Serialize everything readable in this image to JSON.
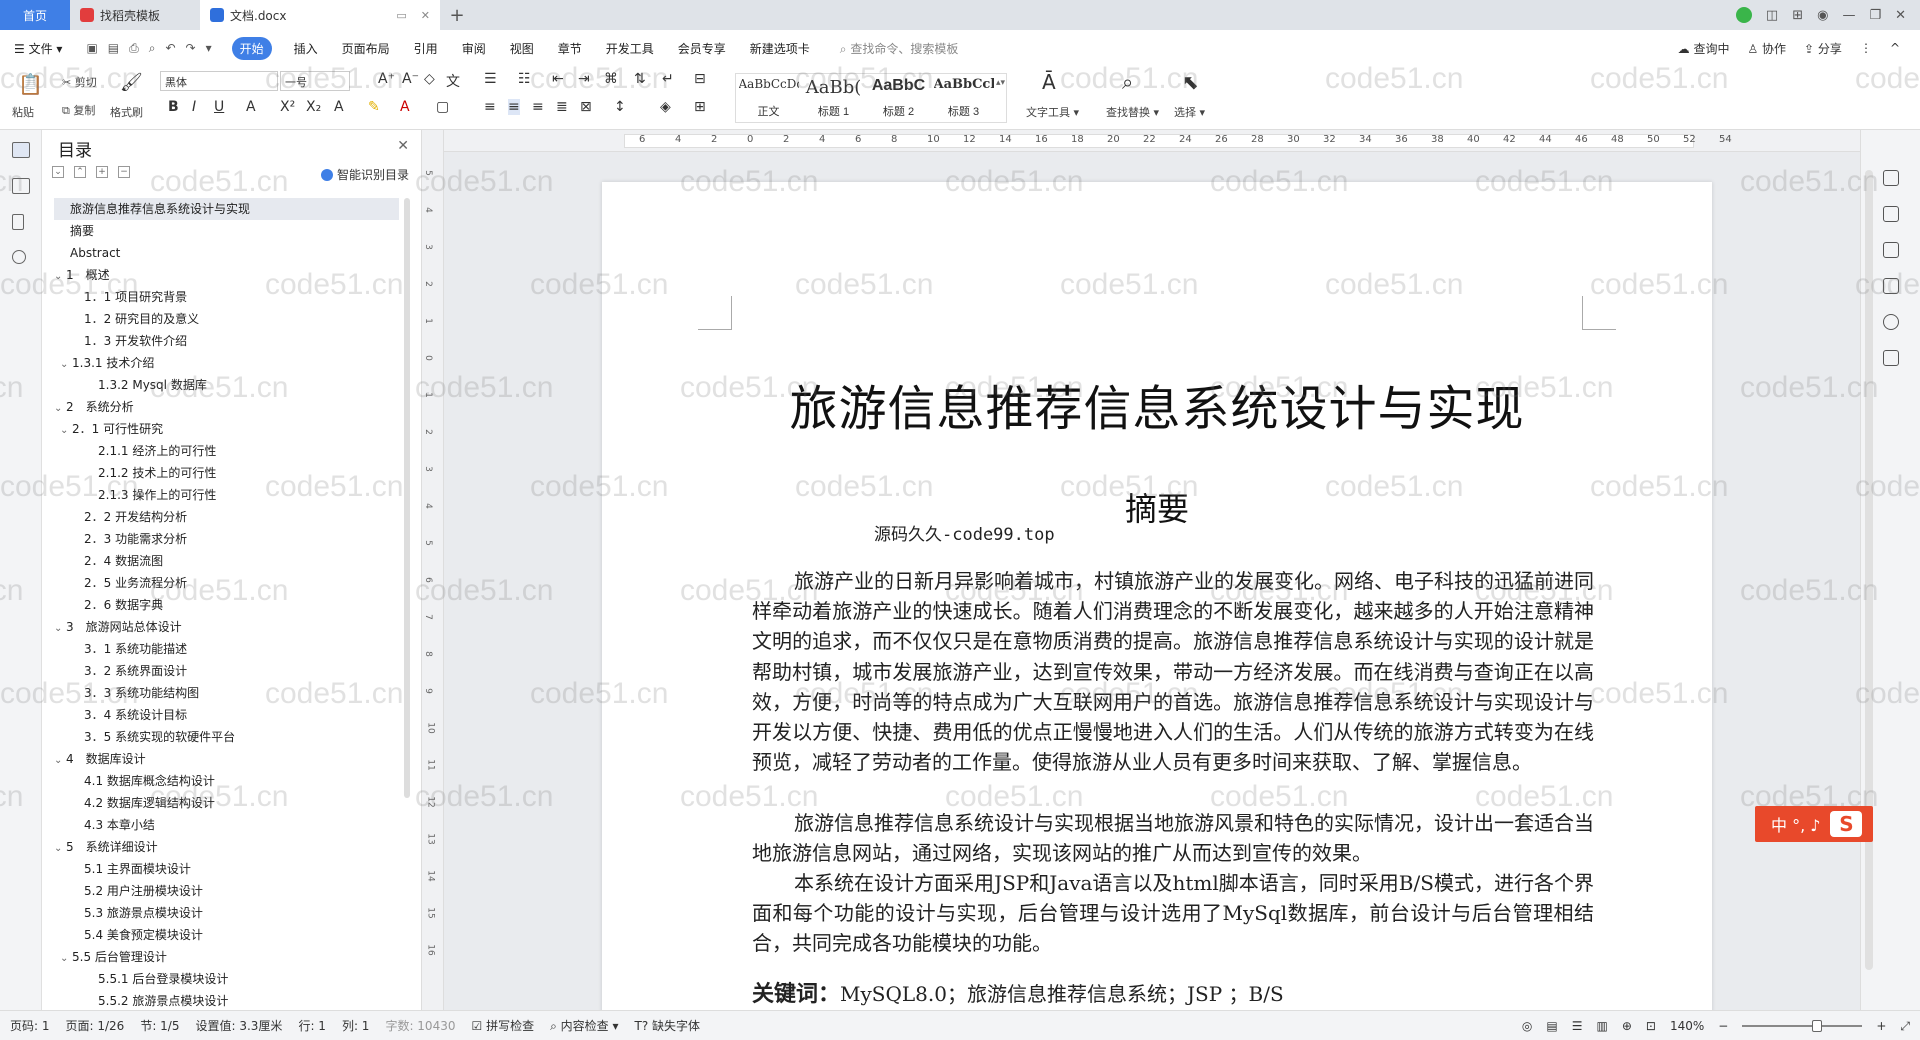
{
  "tabs": {
    "home": "首页",
    "template": "找稻壳模板",
    "doc": "文档.docx"
  },
  "menu": {
    "file": "文件",
    "items": [
      "开始",
      "插入",
      "页面布局",
      "引用",
      "审阅",
      "视图",
      "章节",
      "开发工具",
      "会员专享",
      "新建选项卡"
    ],
    "search_placeholder": "查找命令、搜索模板",
    "right": [
      "查询中",
      "协作",
      "分享"
    ]
  },
  "ribbon": {
    "paste": "粘贴",
    "cut": "剪切",
    "copy": "复制",
    "format_painter": "格式刷",
    "font_name": "黑体",
    "font_size": "一号",
    "styles": [
      {
        "preview": "AaBbCcDd",
        "label": "正文"
      },
      {
        "preview": "AaBb(",
        "label": "标题 1"
      },
      {
        "preview": "AaBbC",
        "label": "标题 2"
      },
      {
        "preview": "AaBbCcl",
        "label": "标题 3"
      }
    ],
    "text_tools": "文字工具",
    "find_replace": "查找替换",
    "select": "选择"
  },
  "toc": {
    "title": "目录",
    "smart": "智能识别目录",
    "items": [
      {
        "t": "旅游信息推荐信息系统设计与实现",
        "lvl": 0,
        "sel": true
      },
      {
        "t": "摘要",
        "lvl": 0
      },
      {
        "t": "Abstract",
        "lvl": 0
      },
      {
        "t": "1　概述",
        "lvl": 0,
        "arrow": true
      },
      {
        "t": "1．1 项目研究背景",
        "lvl": 1
      },
      {
        "t": "1．2 研究目的及意义",
        "lvl": 1
      },
      {
        "t": "1．3 开发软件介绍",
        "lvl": 1
      },
      {
        "t": "1.3.1 技术介绍",
        "lvl": 1,
        "arrow": true
      },
      {
        "t": "1.3.2 Mysql 数据库",
        "lvl": 2
      },
      {
        "t": "2　系统分析",
        "lvl": 0,
        "arrow": true
      },
      {
        "t": "2．1 可行性研究",
        "lvl": 1,
        "arrow": true
      },
      {
        "t": "2.1.1 经济上的可行性",
        "lvl": 2
      },
      {
        "t": "2.1.2 技术上的可行性",
        "lvl": 2
      },
      {
        "t": "2.1.3 操作上的可行性",
        "lvl": 2
      },
      {
        "t": "2．2 开发结构分析",
        "lvl": 1
      },
      {
        "t": "2．3 功能需求分析",
        "lvl": 1
      },
      {
        "t": "2．4 数据流图",
        "lvl": 1
      },
      {
        "t": "2．5 业务流程分析",
        "lvl": 1
      },
      {
        "t": "2．6 数据字典",
        "lvl": 1
      },
      {
        "t": "3　旅游网站总体设计",
        "lvl": 0,
        "arrow": true
      },
      {
        "t": "3．1 系统功能描述",
        "lvl": 1
      },
      {
        "t": "3．2 系统界面设计",
        "lvl": 1
      },
      {
        "t": "3．3 系统功能结构图",
        "lvl": 1
      },
      {
        "t": "3．4 系统设计目标",
        "lvl": 1
      },
      {
        "t": "3．5 系统实现的软硬件平台",
        "lvl": 1
      },
      {
        "t": "4　数据库设计",
        "lvl": 0,
        "arrow": true
      },
      {
        "t": "4.1 数据库概念结构设计",
        "lvl": 1
      },
      {
        "t": "4.2 数据库逻辑结构设计",
        "lvl": 1
      },
      {
        "t": "4.3 本章小结",
        "lvl": 1
      },
      {
        "t": "5　系统详细设计",
        "lvl": 0,
        "arrow": true
      },
      {
        "t": "5.1 主界面模块设计",
        "lvl": 1
      },
      {
        "t": "5.2 用户注册模块设计",
        "lvl": 1
      },
      {
        "t": "5.3 旅游景点模块设计",
        "lvl": 1
      },
      {
        "t": "5.4 美食预定模块设计",
        "lvl": 1
      },
      {
        "t": "5.5 后台管理设计",
        "lvl": 1,
        "arrow": true
      },
      {
        "t": "5.5.1 后台登录模块设计",
        "lvl": 2
      },
      {
        "t": "5.5.2 旅游景点模块设计",
        "lvl": 2
      }
    ]
  },
  "doc": {
    "title": "旅游信息推荐信息系统设计与实现",
    "abstract_heading": "摘要",
    "source_note": "源码久久-code99.top",
    "paragraphs": [
      "旅游产业的日新月异影响着城市，村镇旅游产业的发展变化。网络、电子科技的迅猛前进同样牵动着旅游产业的快速成长。随着人们消费理念的不断发展变化，越来越多的人开始注意精神文明的追求，而不仅仅只是在意物质消费的提高。旅游信息推荐信息系统设计与实现的设计就是帮助村镇，城市发展旅游产业，达到宣传效果，带动一方经济发展。而在线消费与查询正在以高效，方便，时尚等的特点成为广大互联网用户的首选。旅游信息推荐信息系统设计与实现设计与开发以方便、快捷、费用低的优点正慢慢地进入人们的生活。人们从传统的旅游方式转变为在线预览，减轻了劳动者的工作量。使得旅游从业人员有更多时间来获取、了解、掌握信息。",
      "旅游信息推荐信息系统设计与实现根据当地旅游风景和特色的实际情况，设计出一套适合当地旅游信息网站，通过网络，实现该网站的推广从而达到宣传的效果。",
      "本系统在设计方面采用JSP和Java语言以及html脚本语言，同时采用B/S模式，进行各个界面和每个功能的设计与实现，后台管理与设计选用了MySql数据库，前台设计与后台管理相结合，共同完成各功能模块的功能。"
    ],
    "keywords_label": "关键词：",
    "keywords": "MySQL8.0；旅游信息推荐信息系统；JSP ；B/S"
  },
  "watermark": "code51.cn",
  "ime": {
    "text": "中 °, ♪",
    "logo": "S"
  },
  "status": {
    "page_code": "页码: 1",
    "page": "页面: 1/26",
    "section": "节: 1/5",
    "setting": "设置值: 3.3厘米",
    "row": "行: 1",
    "col": "列: 1",
    "words": "字数: 10430",
    "spell": "拼写检查",
    "content_check": "内容检查",
    "missing_font": "缺失字体",
    "zoom": "140%"
  }
}
